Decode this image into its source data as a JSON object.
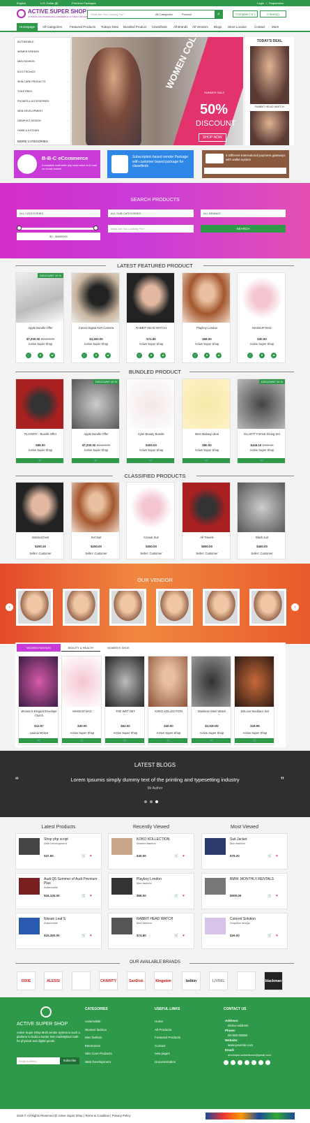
{
  "topbar": {
    "language": "English",
    "currency": "U.S. Dollar ($)",
    "premium": "Premium Packages",
    "login": "Login",
    "sep": "/",
    "register": "Registration"
  },
  "header": {
    "logo": "ACTIVE SUPER SHOP",
    "tagline": "ULTIMATE MULTIVENDOR E-COMMERCE SYSTEM FOR MARKETS",
    "search_placeholder": "What Are You Looking For?",
    "category": "All Categories",
    "type": "Product",
    "compare": "Compare ( 0 )",
    "cart": "0 item(s)"
  },
  "nav": [
    "Homepage",
    "All Categories",
    "Featured Products",
    "Todays Deal",
    "Bundled Product",
    "Classifieds",
    "All Brands",
    "All Vendors",
    "Blogs",
    "Store Locator",
    "Contact",
    "More"
  ],
  "categories": [
    "AUTOMOBILE",
    "WOMEN FASHION",
    "MEN FASHION",
    "ELECTRONICS",
    "SKIN CARE PRODUCTS",
    "TOILETRIES",
    "PHONES & ACCESSORIES",
    "WEB DEVELOPMENT",
    "GRAPHICS DESIGN",
    "HOME & KITCHEN"
  ],
  "more_categories": "MORE CATEGORIES",
  "hero": {
    "collection": "WOMEN COLLECTION",
    "sale": "SUMMER SALE",
    "pct": "50%",
    "discount": "DISCOUNT",
    "shop": "SHOP NOW"
  },
  "today": {
    "title": "TODAY'S DEAL",
    "item": "RABBIT HEAD WATCH"
  },
  "promos": {
    "p1_title": "B-B-C eCommerce",
    "p1_text": "A complete multi seller php script which is #1 sold on envato market",
    "p2_text": "Subscription based vendor Package with customer based package for classifieds",
    "p3_text": "5 Different International payment gateways with wallet system"
  },
  "search": {
    "title": "SEARCH PRODUCTS",
    "cat": "ALL CATEGORIES",
    "subcat": "ALL SUB CATEGORIES",
    "brand": "ALL BRANDS",
    "range": "$0 - $4890000",
    "placeholder": "What Are You Looking For?",
    "button": "SEARCH"
  },
  "featured": {
    "title": "LATEST FEATURED PRODUCT",
    "discount": "DISCOUNT 10 %",
    "items": [
      {
        "name": "Apple Bundle Offer",
        "price": "$7,200.00",
        "old": "$8,000.00",
        "seller": "Active Super Shop"
      },
      {
        "name": "Canon Digital SLR Camera",
        "price": "$3,500.00",
        "old": "",
        "seller": "Active Super Shop"
      },
      {
        "name": "RABBIT HEAD WATCH",
        "price": "$74.80",
        "old": "",
        "seller": "Active Super Shop"
      },
      {
        "name": "Playboy London",
        "price": "$68.00",
        "old": "",
        "seller": "Active Super Shop"
      },
      {
        "name": "MAKEUP BAG",
        "price": "$30.00",
        "old": "",
        "seller": "Active Super Shop"
      }
    ]
  },
  "bundled": {
    "title": "BUNDLED PRODUCT",
    "discount": "DISCOUNT 10 %",
    "items": [
      {
        "name": "PLAYBOY - Bundle Offer",
        "price": "$98.00",
        "old": "",
        "seller": "Active Super Shop"
      },
      {
        "name": "Apple Bundle Offer",
        "price": "$7,200.00",
        "old": "$8,000.00",
        "seller": "Active Super Shop"
      },
      {
        "name": "Kylie Beauty Bundle",
        "price": "$300.00",
        "old": "",
        "seller": "Active Super Shop"
      },
      {
        "name": "Best Makeup deal",
        "price": "$80.00",
        "old": "",
        "seller": "Active Super Shop"
      },
      {
        "name": "ELLIOTT Formal Dining Set",
        "price": "$449.10",
        "old": "$499.00",
        "seller": "Active Super Shop"
      }
    ]
  },
  "classified": {
    "title": "CLASSIFIED PRODUCTS",
    "items": [
      {
        "name": "Stocked heel",
        "price": "$290.30",
        "seller": "Seller: Customer"
      },
      {
        "name": "Set Suit",
        "price": "$250.00",
        "seller": "Seller: Customer"
      },
      {
        "name": "Casual Suit",
        "price": "$350.00",
        "seller": "Seller: Customer"
      },
      {
        "name": "All Travels",
        "price": "$850.00",
        "seller": "Seller: Customer"
      },
      {
        "name": "Black suit",
        "price": "$460.00",
        "seller": "Seller: Customer"
      }
    ]
  },
  "vendor": {
    "title": "OUR VENDOR"
  },
  "tabs": {
    "labels": [
      "WOMEN FASHION",
      "BEAUTY & HEALTH",
      "WOMEN'S SHOE"
    ],
    "items": [
      {
        "name": "Women's Elegant Envelope Clutch",
        "price": "$12.97",
        "seller": "Lavinia Mckee"
      },
      {
        "name": "MAKEUP BAG",
        "price": "$30.00",
        "seller": "Active Super Shop"
      },
      {
        "name": "THE WET SET",
        "price": "$62.00",
        "seller": "Active Super Shop"
      },
      {
        "name": "KOKO KOLLECTION",
        "price": "$40.00",
        "seller": "Active Super Shop"
      },
      {
        "name": "Stainless Steel Watch",
        "price": "$4,530.00",
        "seller": "Active Super Shop"
      },
      {
        "name": "BriLove Necklace Set",
        "price": "$18.95",
        "seller": "Active Super Shop"
      }
    ]
  },
  "blogs": {
    "title": "LATEST BLOGS",
    "quote": "Lorem Ipsumis simply dummy text of the printing and typesetting industry",
    "author": "Mr Author",
    "open_quote": "“",
    "close_quote": "”"
  },
  "lists": {
    "latest_title": "Latest Products",
    "recent_title": "Recently Viewed",
    "most_title": "Most Viewed",
    "latest": [
      {
        "name": "Shop php script",
        "cat": "Web Development",
        "price": "$37.50"
      },
      {
        "name": "Audi Q5 Summer of Audi Premium Plus",
        "cat": "Automobile",
        "price": "$44,100.00"
      },
      {
        "name": "Nissan Leaf S",
        "cat": "Automobile",
        "price": "$15,350.00"
      }
    ],
    "recent": [
      {
        "name": "KOKO KOLLECTION",
        "cat": "Women fashion",
        "price": "$40.00"
      },
      {
        "name": "Playboy London",
        "cat": "Men fashion",
        "price": "$68.00"
      },
      {
        "name": "RABBIT HEAD WATCH",
        "cat": "Men fashion",
        "price": "$74.80"
      }
    ],
    "most": [
      {
        "name": "Suit Jacket",
        "cat": "Men fashion",
        "price": "$79.20"
      },
      {
        "name": "BMW: MONTHLY RENTALS",
        "cat": "",
        "price": "$909.09"
      },
      {
        "name": "Colored Solution",
        "cat": "Graphics design",
        "price": "$26.00"
      }
    ]
  },
  "brands": {
    "title": "OUR AVAILABLE BRANDS",
    "items": [
      "DIXIE",
      "ALESSI",
      "",
      "CHARITY",
      "SanDisk",
      "Kingston",
      "belkin",
      "LIVING",
      "",
      "blackman"
    ]
  },
  "footer": {
    "logo": "ACTIVE SUPER SHOP",
    "about": "Active Super Shop Multi vendor system is such a platform to build a border less marketplace both for physical and digital goods.",
    "email_placeholder": "Email Address",
    "subscribe": "Subscribe",
    "categories_title": "CATEGORIES",
    "categories": [
      "Automobile",
      "Women fashion",
      "Men fashion",
      "Electronics",
      "Skin Care Products",
      "Web Development"
    ],
    "links_title": "USEFUL LINKS",
    "links": [
      "Home",
      "All Products",
      "Featured Products",
      "Contact",
      "new page1",
      "Documentation"
    ],
    "contact_title": "CONTACT US",
    "address_label": "Address:",
    "address": "Demo Address",
    "phone_label": "Phone:",
    "phone": "00-000-00000",
    "website_label": "Website:",
    "website": "www.yoursite.com",
    "email_label": "Email:",
    "email": "developer.activeitzone@gmail.com",
    "copyright": "2018 © All Rights Reserved @ Active Super Shop | Terms & Condition | Privacy Policy"
  },
  "colors": {
    "green": "#2e9a49",
    "magenta": "#c93bd8",
    "orange": "#f08840",
    "pink": "#e3336c"
  }
}
